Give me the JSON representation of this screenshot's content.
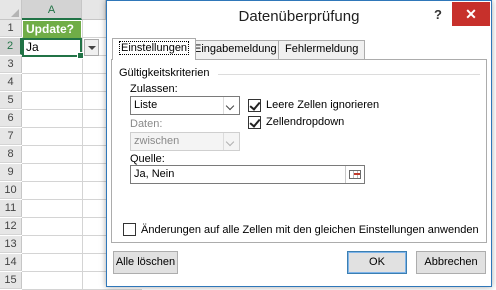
{
  "spreadsheet": {
    "column_header": "A",
    "row_numbers": [
      "1",
      "2",
      "3",
      "4",
      "5",
      "6",
      "7",
      "8",
      "9",
      "10",
      "11",
      "12",
      "13",
      "14",
      "15"
    ],
    "header_cell": "Update?",
    "active_cell": "Ja"
  },
  "dialog": {
    "title": "Datenüberprüfung",
    "help": "?",
    "close": "✕",
    "tabs": [
      {
        "label": "Einstellungen"
      },
      {
        "label": "Eingabemeldung"
      },
      {
        "label": "Fehlermeldung"
      }
    ],
    "group_label": "Gültigkeitskriterien",
    "allow_label": "Zulassen:",
    "allow_value": "Liste",
    "data_label": "Daten:",
    "data_value": "zwischen",
    "ignore_blank_label": "Leere Zellen ignorieren",
    "in_cell_dropdown_label": "Zellendropdown",
    "source_label": "Quelle:",
    "source_value": "Ja, Nein",
    "apply_all_label": "Änderungen auf alle Zellen mit den gleichen Einstellungen anwenden",
    "clear_all_button": "Alle löschen",
    "ok_button": "OK",
    "cancel_button": "Abbrechen"
  }
}
